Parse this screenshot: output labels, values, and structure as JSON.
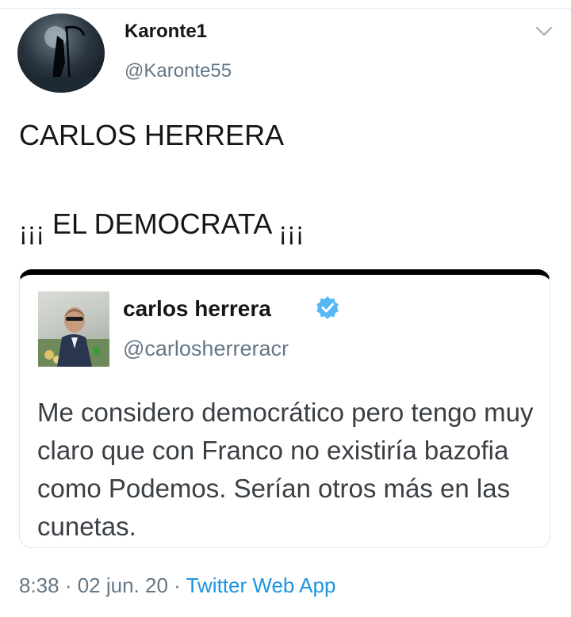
{
  "author": {
    "display_name": "Karonte1",
    "handle": "@Karonte55"
  },
  "tweet": {
    "line1": "CARLOS HERRERA",
    "line2_open": "¡¡¡",
    "line2_text": "EL DEMOCRATA",
    "line2_close": "¡¡¡"
  },
  "quoted_tweet": {
    "display_name": "carlos herrera",
    "handle": "@carlosherreracr",
    "verified": true,
    "text": "Me considero democrático pero tengo muy claro que con Franco no existiría bazofia como Podemos. Serían otros más en las cunetas."
  },
  "meta": {
    "time": "8:38",
    "sep1": " · ",
    "date": "02 jun. 20",
    "sep2": " · ",
    "source": "Twitter Web App"
  },
  "icons": {
    "caret": "chevron-down-icon",
    "verified": "verified-badge-icon"
  },
  "colors": {
    "link": "#1b95e0",
    "secondary_text": "#657786",
    "verified_badge": "#1da1f2"
  }
}
